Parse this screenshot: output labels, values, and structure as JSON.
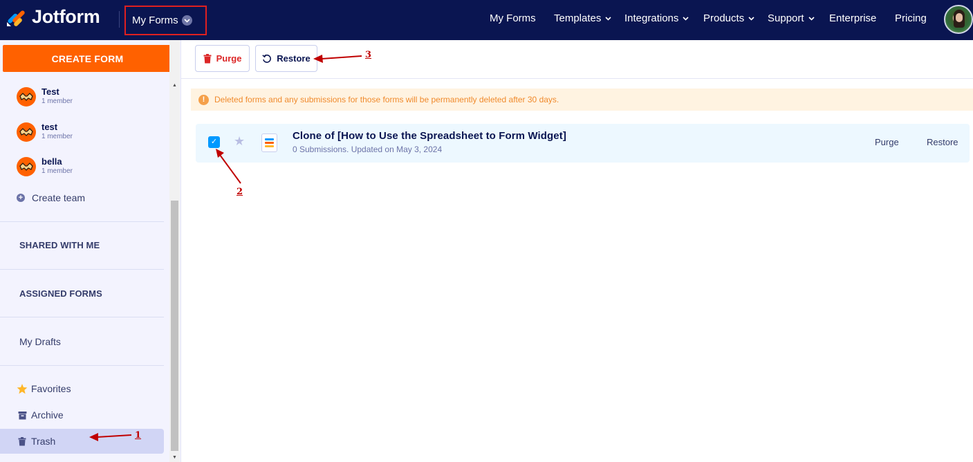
{
  "header": {
    "logo_text": "Jotform",
    "switcher_label": "My Forms",
    "nav": [
      {
        "label": "My Forms"
      },
      {
        "label": "Templates"
      },
      {
        "label": "Integrations"
      },
      {
        "label": "Products"
      },
      {
        "label": "Support"
      },
      {
        "label": "Enterprise"
      },
      {
        "label": "Pricing"
      }
    ]
  },
  "sidebar": {
    "create_label": "CREATE FORM",
    "teams": [
      {
        "name": "Test",
        "members": "1 member"
      },
      {
        "name": "test",
        "members": "1 member"
      },
      {
        "name": "bella",
        "members": "1 member"
      }
    ],
    "create_team_label": "Create team",
    "shared_label": "SHARED WITH ME",
    "assigned_label": "ASSIGNED FORMS",
    "drafts_label": "My Drafts",
    "favorites_label": "Favorites",
    "archive_label": "Archive",
    "trash_label": "Trash"
  },
  "toolbar": {
    "purge_label": "Purge",
    "restore_label": "Restore"
  },
  "notice": {
    "text": "Deleted forms and any submissions for those forms will be permanently deleted after 30 days."
  },
  "forms": [
    {
      "title": "Clone of [How to Use the Spreadsheet to Form Widget]",
      "meta": "0 Submissions. Updated on May 3, 2024",
      "purge_label": "Purge",
      "restore_label": "Restore"
    }
  ],
  "annotations": {
    "one": "1",
    "two": "2",
    "three": "3"
  },
  "colors": {
    "nav_bg": "#0a1551",
    "accent": "#ff6100",
    "danger": "#dc2626",
    "annotation": "#c00000",
    "selected_row": "#edf8ff"
  }
}
